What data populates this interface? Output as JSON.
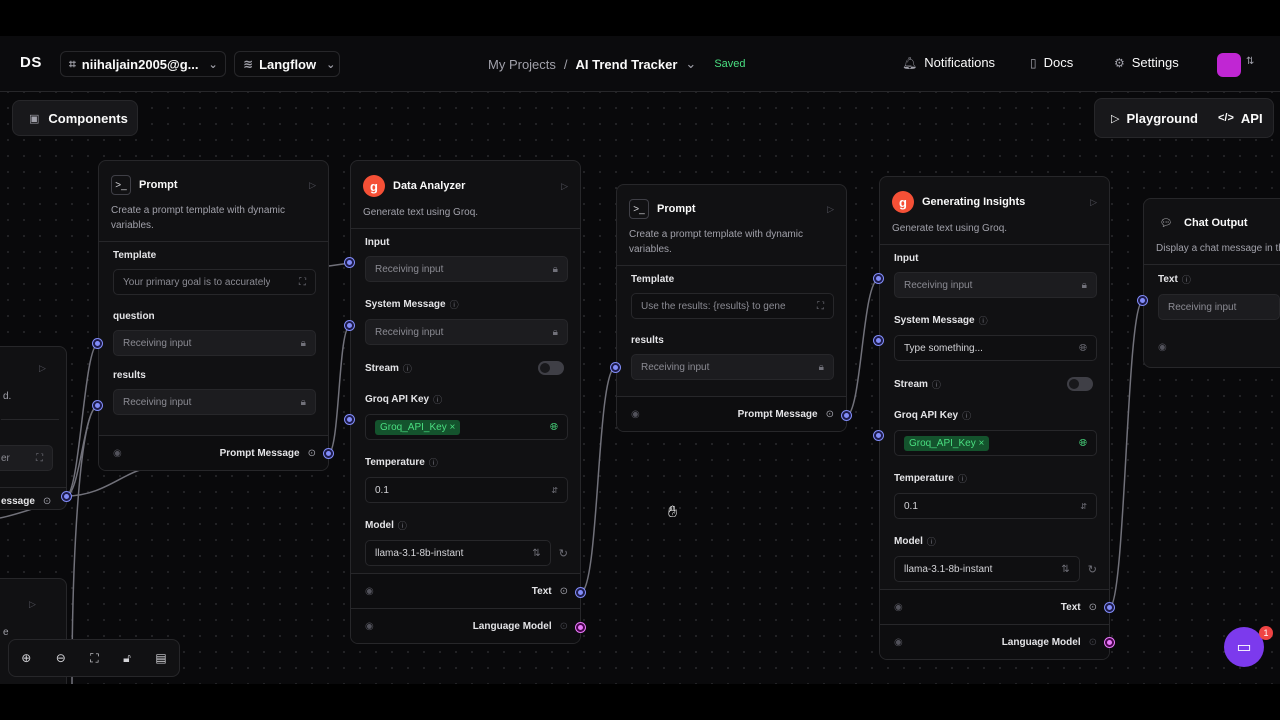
{
  "header": {
    "logo": "DS",
    "org_label": "niihaljain2005@g...",
    "project_selector": "Langflow",
    "breadcrumb_root": "My Projects",
    "breadcrumb_sep": "/",
    "flow_name": "AI Trend Tracker",
    "save_status": "Saved",
    "notifications": "Notifications",
    "docs": "Docs",
    "settings": "Settings"
  },
  "toolbar": {
    "components": "Components",
    "playground": "Playground",
    "api": "API"
  },
  "left_partial": {
    "desc_fragment": "d.",
    "input_fragment": "er",
    "output_fragment": "essage",
    "label_fragment": "e"
  },
  "prompt1": {
    "title": "Prompt",
    "description": "Create a prompt template with dynamic variables.",
    "template_label": "Template",
    "template_value": "Your primary goal is to accurately",
    "question_label": "question",
    "question_value": "Receiving input",
    "results_label": "results",
    "results_value": "Receiving input",
    "output_label": "Prompt Message"
  },
  "analyzer": {
    "title": "Data Analyzer",
    "description": "Generate text using Groq.",
    "input_label": "Input",
    "input_value": "Receiving input",
    "system_label": "System Message",
    "system_value": "Receiving input",
    "stream_label": "Stream",
    "key_label": "Groq API Key",
    "key_value": "Groq_API_Key",
    "temp_label": "Temperature",
    "temp_value": "0.1",
    "model_label": "Model",
    "model_value": "llama-3.1-8b-instant",
    "out_text": "Text",
    "out_model": "Language Model"
  },
  "prompt2": {
    "title": "Prompt",
    "description": "Create a prompt template with dynamic variables.",
    "template_label": "Template",
    "template_value": "Use the results: {results} to gene",
    "results_label": "results",
    "results_value": "Receiving input",
    "output_label": "Prompt Message"
  },
  "insights": {
    "title": "Generating Insights",
    "description": "Generate text using Groq.",
    "input_label": "Input",
    "input_value": "Receiving input",
    "system_label": "System Message",
    "system_placeholder": "Type something...",
    "stream_label": "Stream",
    "key_label": "Groq API Key",
    "key_value": "Groq_API_Key",
    "temp_label": "Temperature",
    "temp_value": "0.1",
    "model_label": "Model",
    "model_value": "llama-3.1-8b-instant",
    "out_text": "Text",
    "out_model": "Language Model"
  },
  "chat_output": {
    "title": "Chat Output",
    "description": "Display a chat message in th",
    "text_label": "Text",
    "text_value": "Receiving input"
  },
  "notifications_badge": "1",
  "colors": {
    "accent": "#7c3aed",
    "handle": "#818cf8",
    "model_handle": "#e879f9",
    "saved": "#4ade80",
    "groq": "#f55036"
  }
}
